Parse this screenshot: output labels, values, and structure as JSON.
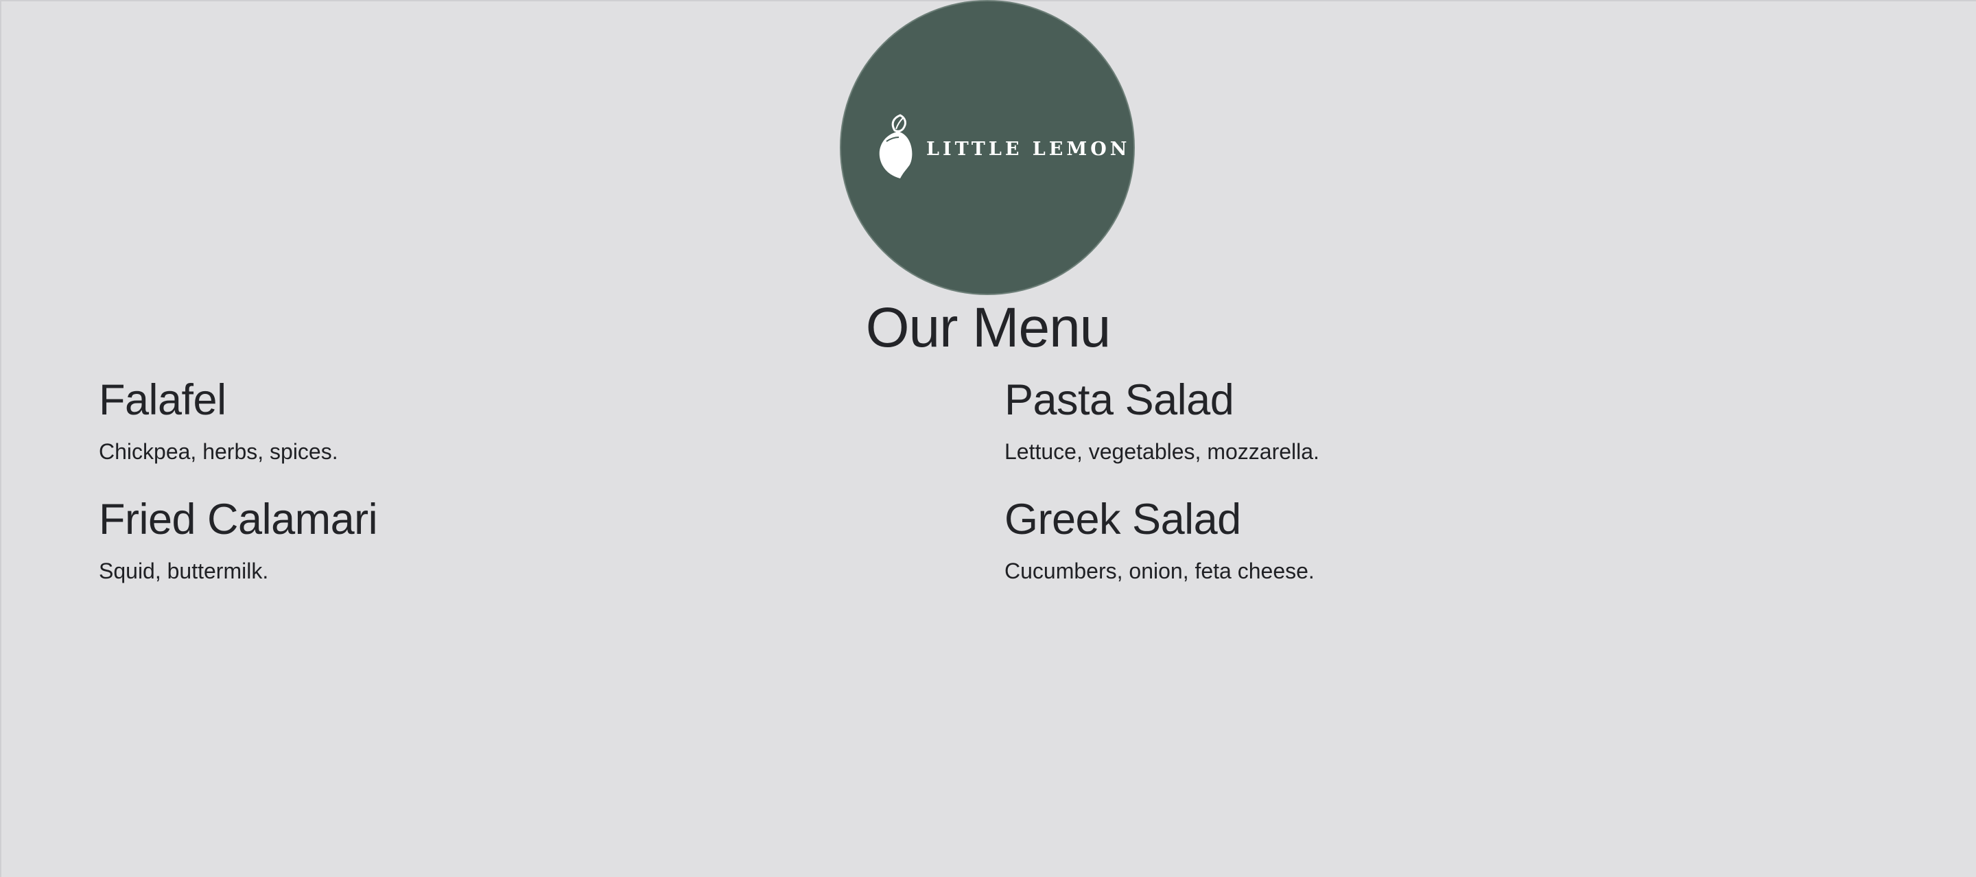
{
  "logo": {
    "text": "LITTLE LEMON",
    "icon": "lemon-icon",
    "background_color": "#4a5e57"
  },
  "page": {
    "title": "Our Menu",
    "background_color": "#e0e0e2"
  },
  "menu": {
    "items": [
      {
        "name": "Falafel",
        "description": "Chickpea, herbs, spices."
      },
      {
        "name": "Pasta Salad",
        "description": "Lettuce, vegetables, mozzarella."
      },
      {
        "name": "Fried Calamari",
        "description": "Squid, buttermilk."
      },
      {
        "name": "Greek Salad",
        "description": "Cucumbers, onion, feta cheese."
      }
    ]
  }
}
